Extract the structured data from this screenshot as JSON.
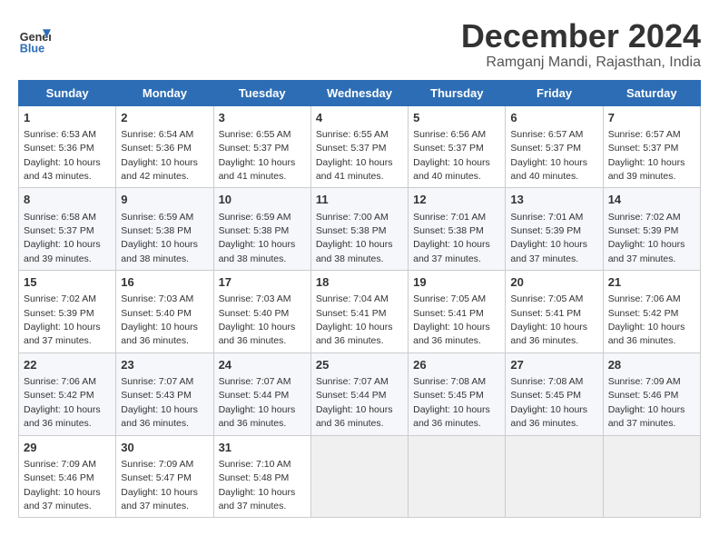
{
  "logo": {
    "line1": "General",
    "line2": "Blue"
  },
  "title": "December 2024",
  "location": "Ramganj Mandi, Rajasthan, India",
  "days_of_week": [
    "Sunday",
    "Monday",
    "Tuesday",
    "Wednesday",
    "Thursday",
    "Friday",
    "Saturday"
  ],
  "weeks": [
    [
      {
        "day": 1,
        "sunrise": "6:53 AM",
        "sunset": "5:36 PM",
        "daylight": "10 hours and 43 minutes."
      },
      {
        "day": 2,
        "sunrise": "6:54 AM",
        "sunset": "5:36 PM",
        "daylight": "10 hours and 42 minutes."
      },
      {
        "day": 3,
        "sunrise": "6:55 AM",
        "sunset": "5:37 PM",
        "daylight": "10 hours and 41 minutes."
      },
      {
        "day": 4,
        "sunrise": "6:55 AM",
        "sunset": "5:37 PM",
        "daylight": "10 hours and 41 minutes."
      },
      {
        "day": 5,
        "sunrise": "6:56 AM",
        "sunset": "5:37 PM",
        "daylight": "10 hours and 40 minutes."
      },
      {
        "day": 6,
        "sunrise": "6:57 AM",
        "sunset": "5:37 PM",
        "daylight": "10 hours and 40 minutes."
      },
      {
        "day": 7,
        "sunrise": "6:57 AM",
        "sunset": "5:37 PM",
        "daylight": "10 hours and 39 minutes."
      }
    ],
    [
      {
        "day": 8,
        "sunrise": "6:58 AM",
        "sunset": "5:37 PM",
        "daylight": "10 hours and 39 minutes."
      },
      {
        "day": 9,
        "sunrise": "6:59 AM",
        "sunset": "5:38 PM",
        "daylight": "10 hours and 38 minutes."
      },
      {
        "day": 10,
        "sunrise": "6:59 AM",
        "sunset": "5:38 PM",
        "daylight": "10 hours and 38 minutes."
      },
      {
        "day": 11,
        "sunrise": "7:00 AM",
        "sunset": "5:38 PM",
        "daylight": "10 hours and 38 minutes."
      },
      {
        "day": 12,
        "sunrise": "7:01 AM",
        "sunset": "5:38 PM",
        "daylight": "10 hours and 37 minutes."
      },
      {
        "day": 13,
        "sunrise": "7:01 AM",
        "sunset": "5:39 PM",
        "daylight": "10 hours and 37 minutes."
      },
      {
        "day": 14,
        "sunrise": "7:02 AM",
        "sunset": "5:39 PM",
        "daylight": "10 hours and 37 minutes."
      }
    ],
    [
      {
        "day": 15,
        "sunrise": "7:02 AM",
        "sunset": "5:39 PM",
        "daylight": "10 hours and 37 minutes."
      },
      {
        "day": 16,
        "sunrise": "7:03 AM",
        "sunset": "5:40 PM",
        "daylight": "10 hours and 36 minutes."
      },
      {
        "day": 17,
        "sunrise": "7:03 AM",
        "sunset": "5:40 PM",
        "daylight": "10 hours and 36 minutes."
      },
      {
        "day": 18,
        "sunrise": "7:04 AM",
        "sunset": "5:41 PM",
        "daylight": "10 hours and 36 minutes."
      },
      {
        "day": 19,
        "sunrise": "7:05 AM",
        "sunset": "5:41 PM",
        "daylight": "10 hours and 36 minutes."
      },
      {
        "day": 20,
        "sunrise": "7:05 AM",
        "sunset": "5:41 PM",
        "daylight": "10 hours and 36 minutes."
      },
      {
        "day": 21,
        "sunrise": "7:06 AM",
        "sunset": "5:42 PM",
        "daylight": "10 hours and 36 minutes."
      }
    ],
    [
      {
        "day": 22,
        "sunrise": "7:06 AM",
        "sunset": "5:42 PM",
        "daylight": "10 hours and 36 minutes."
      },
      {
        "day": 23,
        "sunrise": "7:07 AM",
        "sunset": "5:43 PM",
        "daylight": "10 hours and 36 minutes."
      },
      {
        "day": 24,
        "sunrise": "7:07 AM",
        "sunset": "5:44 PM",
        "daylight": "10 hours and 36 minutes."
      },
      {
        "day": 25,
        "sunrise": "7:07 AM",
        "sunset": "5:44 PM",
        "daylight": "10 hours and 36 minutes."
      },
      {
        "day": 26,
        "sunrise": "7:08 AM",
        "sunset": "5:45 PM",
        "daylight": "10 hours and 36 minutes."
      },
      {
        "day": 27,
        "sunrise": "7:08 AM",
        "sunset": "5:45 PM",
        "daylight": "10 hours and 36 minutes."
      },
      {
        "day": 28,
        "sunrise": "7:09 AM",
        "sunset": "5:46 PM",
        "daylight": "10 hours and 37 minutes."
      }
    ],
    [
      {
        "day": 29,
        "sunrise": "7:09 AM",
        "sunset": "5:46 PM",
        "daylight": "10 hours and 37 minutes."
      },
      {
        "day": 30,
        "sunrise": "7:09 AM",
        "sunset": "5:47 PM",
        "daylight": "10 hours and 37 minutes."
      },
      {
        "day": 31,
        "sunrise": "7:10 AM",
        "sunset": "5:48 PM",
        "daylight": "10 hours and 37 minutes."
      },
      null,
      null,
      null,
      null
    ]
  ],
  "labels": {
    "sunrise": "Sunrise: ",
    "sunset": "Sunset: ",
    "daylight": "Daylight: "
  }
}
